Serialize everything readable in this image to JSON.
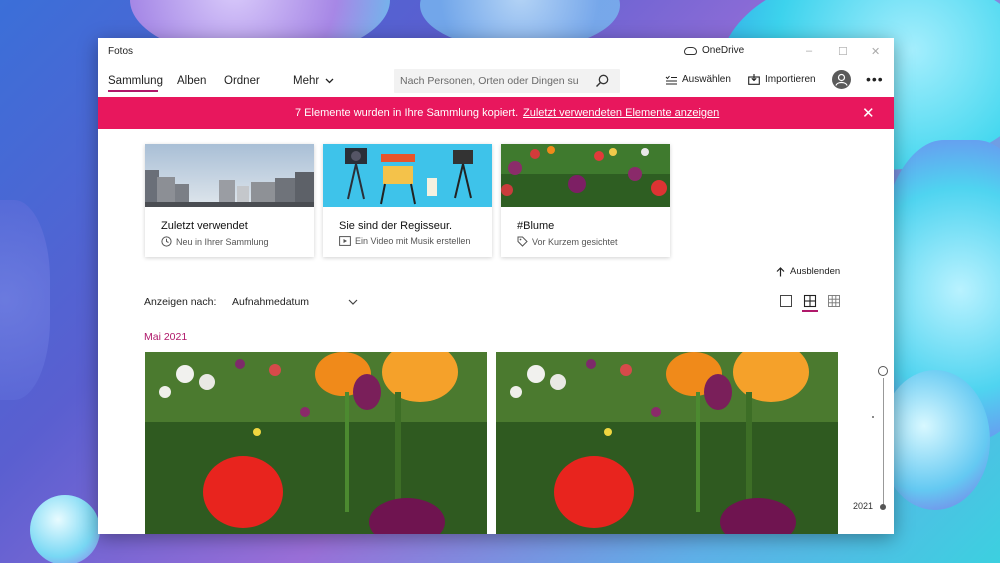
{
  "window": {
    "app_title": "Fotos",
    "onedrive_label": "OneDrive",
    "controls": [
      "–",
      "☐",
      "✕"
    ]
  },
  "nav": {
    "tabs": [
      {
        "label": "Sammlung",
        "active": true
      },
      {
        "label": "Alben",
        "active": false
      },
      {
        "label": "Ordner",
        "active": false
      }
    ],
    "more_label": "Mehr",
    "search_placeholder": "Nach Personen, Orten oder Dingen su",
    "select_label": "Auswählen",
    "import_label": "Importieren"
  },
  "banner": {
    "message": "7 Elemente wurden in Ihre Sammlung kopiert.",
    "link": "Zuletzt verwendeten Elemente anzeigen",
    "color": "#e8175d"
  },
  "cards": [
    {
      "title": "Zuletzt verwendet",
      "subtitle": "Neu in Ihrer Sammlung",
      "icon": "clock-icon"
    },
    {
      "title": "Sie sind der Regisseur.",
      "subtitle": "Ein Video mit Musik erstellen",
      "icon": "video-icon"
    },
    {
      "title": "#Blume",
      "subtitle": "Vor Kurzem gesichtet",
      "icon": "tag-icon"
    }
  ],
  "toolbar": {
    "hide_label": "Ausblenden",
    "sort_label": "Anzeigen nach:",
    "sort_value": "Aufnahmedatum"
  },
  "gallery": {
    "month_label": "Mai 2021",
    "timeline_year": "2021",
    "accent_color": "#b0186a"
  }
}
